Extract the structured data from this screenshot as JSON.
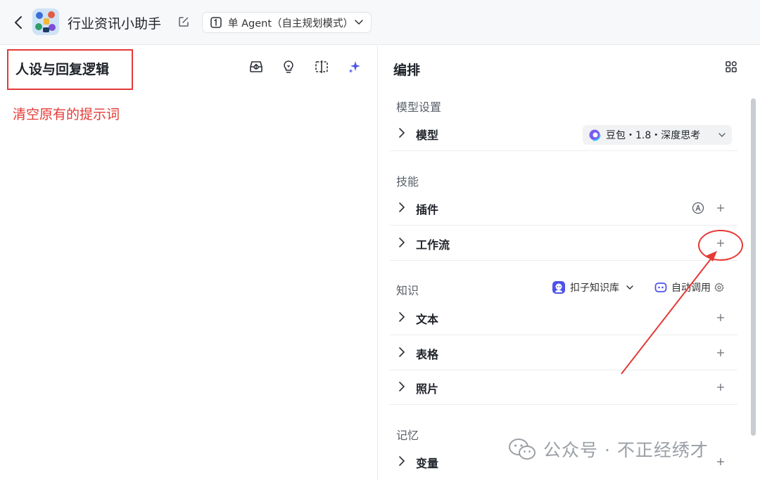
{
  "header": {
    "title": "行业资讯小助手",
    "mode": "单 Agent（自主规划模式）"
  },
  "left": {
    "persona_title": "人设与回复逻辑",
    "annotation": "清空原有的提示词"
  },
  "right": {
    "title": "编排",
    "sections": {
      "model_settings": "模型设置",
      "skills": "技能",
      "knowledge": "知识",
      "memory": "记忆"
    },
    "rows": {
      "model": "模型",
      "plugin": "插件",
      "workflow": "工作流",
      "text": "文本",
      "table": "表格",
      "photo": "照片",
      "variable": "变量"
    },
    "model_value": "豆包・1.8・深度思考",
    "knowledge_base": "扣子知识库",
    "auto_call": "自动调用"
  },
  "watermark": "公众号 · 不正经绣才",
  "colors": {
    "accent": "#4d53e8",
    "annotation_red": "#e53935"
  }
}
